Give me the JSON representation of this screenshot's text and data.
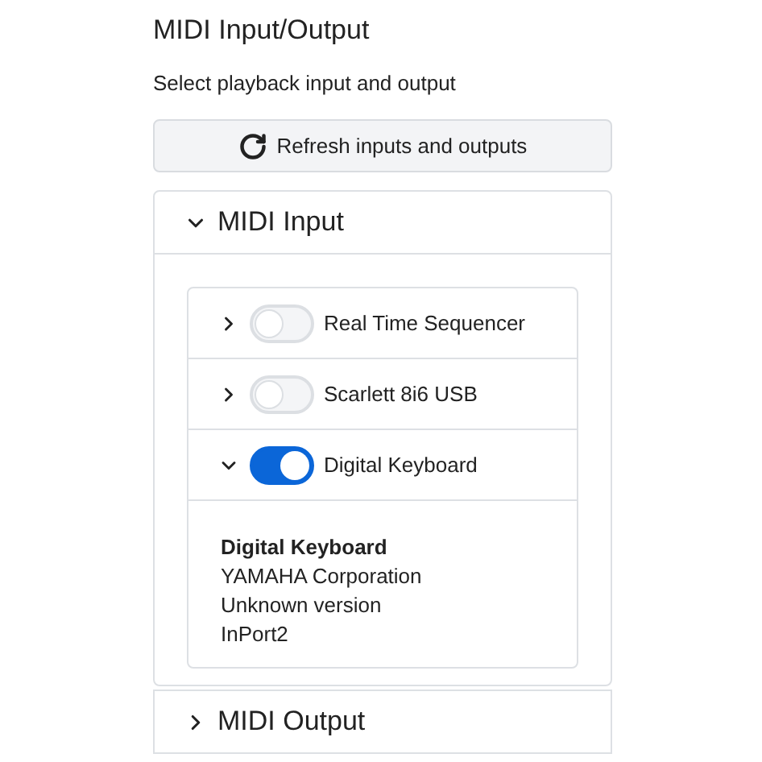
{
  "title": "MIDI Input/Output",
  "subtitle": "Select playback input and output",
  "refresh_button": "Refresh inputs and outputs",
  "sections": [
    {
      "title": "MIDI Input",
      "expanded": true,
      "devices": [
        {
          "name": "Real Time Sequencer",
          "on": false,
          "expanded": false
        },
        {
          "name": "Scarlett 8i6 USB",
          "on": false,
          "expanded": false
        },
        {
          "name": "Digital Keyboard",
          "on": true,
          "expanded": true,
          "details": {
            "name": "Digital Keyboard",
            "lines": [
              "YAMAHA Corporation",
              "Unknown version",
              "InPort2"
            ]
          }
        }
      ]
    },
    {
      "title": "MIDI Output",
      "expanded": false
    }
  ]
}
